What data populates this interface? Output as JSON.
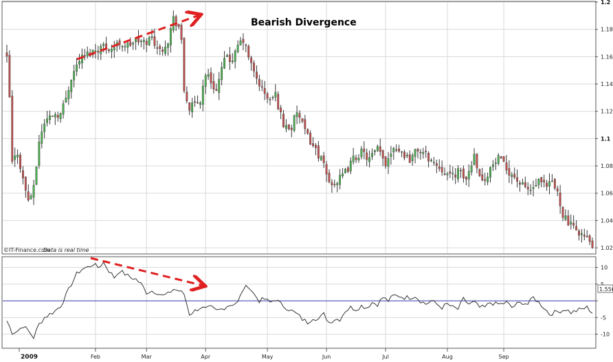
{
  "annotation": {
    "title": "Bearish Divergence",
    "credit": "©IT-Finance.com",
    "credit_note": "Data is real time"
  },
  "colors": {
    "up": "#4caf50",
    "down": "#c0504d",
    "wick": "#333333",
    "oscillator_line": "#333333",
    "zero_line": "#3b3bb0",
    "divergence_arrow": "#e02020"
  },
  "chart_data": [
    {
      "type": "candlestick",
      "title": "Bearish Divergence",
      "ylim": [
        1.016,
        1.2
      ],
      "y_ticks": [
        "1.02",
        "1.04",
        "1.06",
        "1.08",
        "1.1",
        "1.12",
        "1.14",
        "1.16",
        "1.18",
        "1.2"
      ],
      "bold_ticks": [
        "1.1",
        "1.2"
      ],
      "x_year": "2009",
      "x_months": [
        "Feb",
        "Mar",
        "Apr",
        "May",
        "Jun",
        "Jul",
        "Aug",
        "Sep"
      ],
      "grid": true,
      "close_anchors": [
        [
          0,
          1.158
        ],
        [
          1,
          1.13
        ],
        [
          2,
          1.082
        ],
        [
          4,
          1.09
        ],
        [
          6,
          1.07
        ],
        [
          8,
          1.055
        ],
        [
          10,
          1.063
        ],
        [
          12,
          1.098
        ],
        [
          14,
          1.112
        ],
        [
          17,
          1.118
        ],
        [
          20,
          1.118
        ],
        [
          22,
          1.13
        ],
        [
          24,
          1.145
        ],
        [
          27,
          1.158
        ],
        [
          30,
          1.162
        ],
        [
          33,
          1.165
        ],
        [
          36,
          1.168
        ],
        [
          39,
          1.166
        ],
        [
          42,
          1.17
        ],
        [
          45,
          1.168
        ],
        [
          48,
          1.172
        ],
        [
          51,
          1.17
        ],
        [
          54,
          1.174
        ],
        [
          57,
          1.164
        ],
        [
          60,
          1.172
        ],
        [
          62,
          1.188
        ],
        [
          64,
          1.182
        ],
        [
          65,
          1.17
        ],
        [
          66,
          1.135
        ],
        [
          68,
          1.122
        ],
        [
          70,
          1.125
        ],
        [
          72,
          1.128
        ],
        [
          74,
          1.148
        ],
        [
          76,
          1.142
        ],
        [
          78,
          1.135
        ],
        [
          80,
          1.15
        ],
        [
          82,
          1.162
        ],
        [
          84,
          1.155
        ],
        [
          86,
          1.168
        ],
        [
          88,
          1.172
        ],
        [
          90,
          1.16
        ],
        [
          92,
          1.148
        ],
        [
          94,
          1.14
        ],
        [
          96,
          1.132
        ],
        [
          98,
          1.128
        ],
        [
          100,
          1.132
        ],
        [
          103,
          1.11
        ],
        [
          106,
          1.108
        ],
        [
          108,
          1.12
        ],
        [
          111,
          1.105
        ],
        [
          114,
          1.095
        ],
        [
          117,
          1.085
        ],
        [
          120,
          1.068
        ],
        [
          123,
          1.068
        ],
        [
          126,
          1.075
        ],
        [
          129,
          1.085
        ],
        [
          132,
          1.09
        ],
        [
          135,
          1.085
        ],
        [
          138,
          1.092
        ],
        [
          141,
          1.082
        ],
        [
          144,
          1.095
        ],
        [
          147,
          1.09
        ],
        [
          150,
          1.085
        ],
        [
          153,
          1.092
        ],
        [
          156,
          1.088
        ],
        [
          159,
          1.082
        ],
        [
          162,
          1.078
        ],
        [
          165,
          1.072
        ],
        [
          168,
          1.076
        ],
        [
          171,
          1.07
        ],
        [
          174,
          1.088
        ],
        [
          177,
          1.068
        ],
        [
          180,
          1.078
        ],
        [
          183,
          1.085
        ],
        [
          186,
          1.078
        ],
        [
          189,
          1.072
        ],
        [
          192,
          1.065
        ],
        [
          195,
          1.062
        ],
        [
          198,
          1.068
        ],
        [
          201,
          1.064
        ],
        [
          203,
          1.068
        ],
        [
          205,
          1.06
        ],
        [
          207,
          1.045
        ],
        [
          209,
          1.038
        ],
        [
          211,
          1.034
        ],
        [
          213,
          1.032
        ],
        [
          215,
          1.028
        ],
        [
          217,
          1.024
        ],
        [
          218,
          1.022
        ]
      ]
    },
    {
      "type": "line",
      "name": "oscillator",
      "ylim": [
        -14,
        13
      ],
      "y_ticks": [
        "10",
        "5",
        "0",
        "-5",
        "-10"
      ],
      "reference_line": 0,
      "last_value_label": "1.556",
      "anchors": [
        [
          0,
          -6
        ],
        [
          2,
          -9.5
        ],
        [
          4,
          -9
        ],
        [
          6,
          -7.5
        ],
        [
          8,
          -9
        ],
        [
          10,
          -11
        ],
        [
          12,
          -7
        ],
        [
          14,
          -5
        ],
        [
          16,
          -4
        ],
        [
          18,
          -3
        ],
        [
          20,
          -1.5
        ],
        [
          22,
          1.5
        ],
        [
          24,
          5
        ],
        [
          26,
          8
        ],
        [
          28,
          9.5
        ],
        [
          30,
          10
        ],
        [
          32,
          11
        ],
        [
          34,
          10
        ],
        [
          36,
          11.5
        ],
        [
          38,
          9
        ],
        [
          40,
          7
        ],
        [
          42,
          9
        ],
        [
          44,
          8
        ],
        [
          46,
          7
        ],
        [
          48,
          6.5
        ],
        [
          50,
          5
        ],
        [
          52,
          2.5
        ],
        [
          54,
          3
        ],
        [
          56,
          2.5
        ],
        [
          58,
          1.5
        ],
        [
          60,
          2
        ],
        [
          62,
          3.5
        ],
        [
          64,
          3
        ],
        [
          66,
          2
        ],
        [
          68,
          -4
        ],
        [
          70,
          -3
        ],
        [
          72,
          -2
        ],
        [
          74,
          -2.5
        ],
        [
          76,
          -2
        ],
        [
          78,
          -3
        ],
        [
          80,
          -2.5
        ],
        [
          82,
          -1.5
        ],
        [
          84,
          -1
        ],
        [
          86,
          -0.5
        ],
        [
          88,
          3.5
        ],
        [
          90,
          4.5
        ],
        [
          92,
          2
        ],
        [
          94,
          0
        ],
        [
          96,
          0.5
        ],
        [
          98,
          -0.5
        ],
        [
          100,
          0.5
        ],
        [
          102,
          -1
        ],
        [
          104,
          -2
        ],
        [
          106,
          -3
        ],
        [
          108,
          -4
        ],
        [
          110,
          -5.5
        ],
        [
          112,
          -6.5
        ],
        [
          114,
          -5
        ],
        [
          116,
          -5.5
        ],
        [
          118,
          -4
        ],
        [
          120,
          -6.5
        ],
        [
          122,
          -5.5
        ],
        [
          124,
          -5.5
        ],
        [
          126,
          -3
        ],
        [
          128,
          -2
        ],
        [
          130,
          -2.5
        ],
        [
          132,
          -1.5
        ],
        [
          134,
          -2
        ],
        [
          136,
          -0.5
        ],
        [
          138,
          -1
        ],
        [
          140,
          1
        ],
        [
          142,
          0
        ],
        [
          144,
          1.5
        ],
        [
          146,
          1.5
        ],
        [
          148,
          1
        ],
        [
          150,
          1
        ],
        [
          152,
          1.5
        ],
        [
          154,
          0
        ],
        [
          156,
          -1
        ],
        [
          158,
          0
        ],
        [
          160,
          -1
        ],
        [
          162,
          -2
        ],
        [
          164,
          -1
        ],
        [
          166,
          -2
        ],
        [
          168,
          -2.5
        ],
        [
          170,
          0.5
        ],
        [
          172,
          -1
        ],
        [
          174,
          -0.5
        ],
        [
          176,
          -2
        ],
        [
          178,
          -2
        ],
        [
          180,
          -0.5
        ],
        [
          182,
          -1
        ],
        [
          184,
          -1
        ],
        [
          186,
          -0.5
        ],
        [
          188,
          -2
        ],
        [
          190,
          -1
        ],
        [
          192,
          -0.5
        ],
        [
          194,
          -1
        ],
        [
          196,
          1
        ],
        [
          198,
          -0.5
        ],
        [
          200,
          -2
        ],
        [
          202,
          -4
        ],
        [
          204,
          -3.5
        ],
        [
          206,
          -3
        ],
        [
          208,
          -2.5
        ],
        [
          210,
          -3.5
        ],
        [
          212,
          -3
        ],
        [
          214,
          -2.5
        ],
        [
          216,
          -2
        ],
        [
          218,
          -3.5
        ]
      ]
    }
  ]
}
